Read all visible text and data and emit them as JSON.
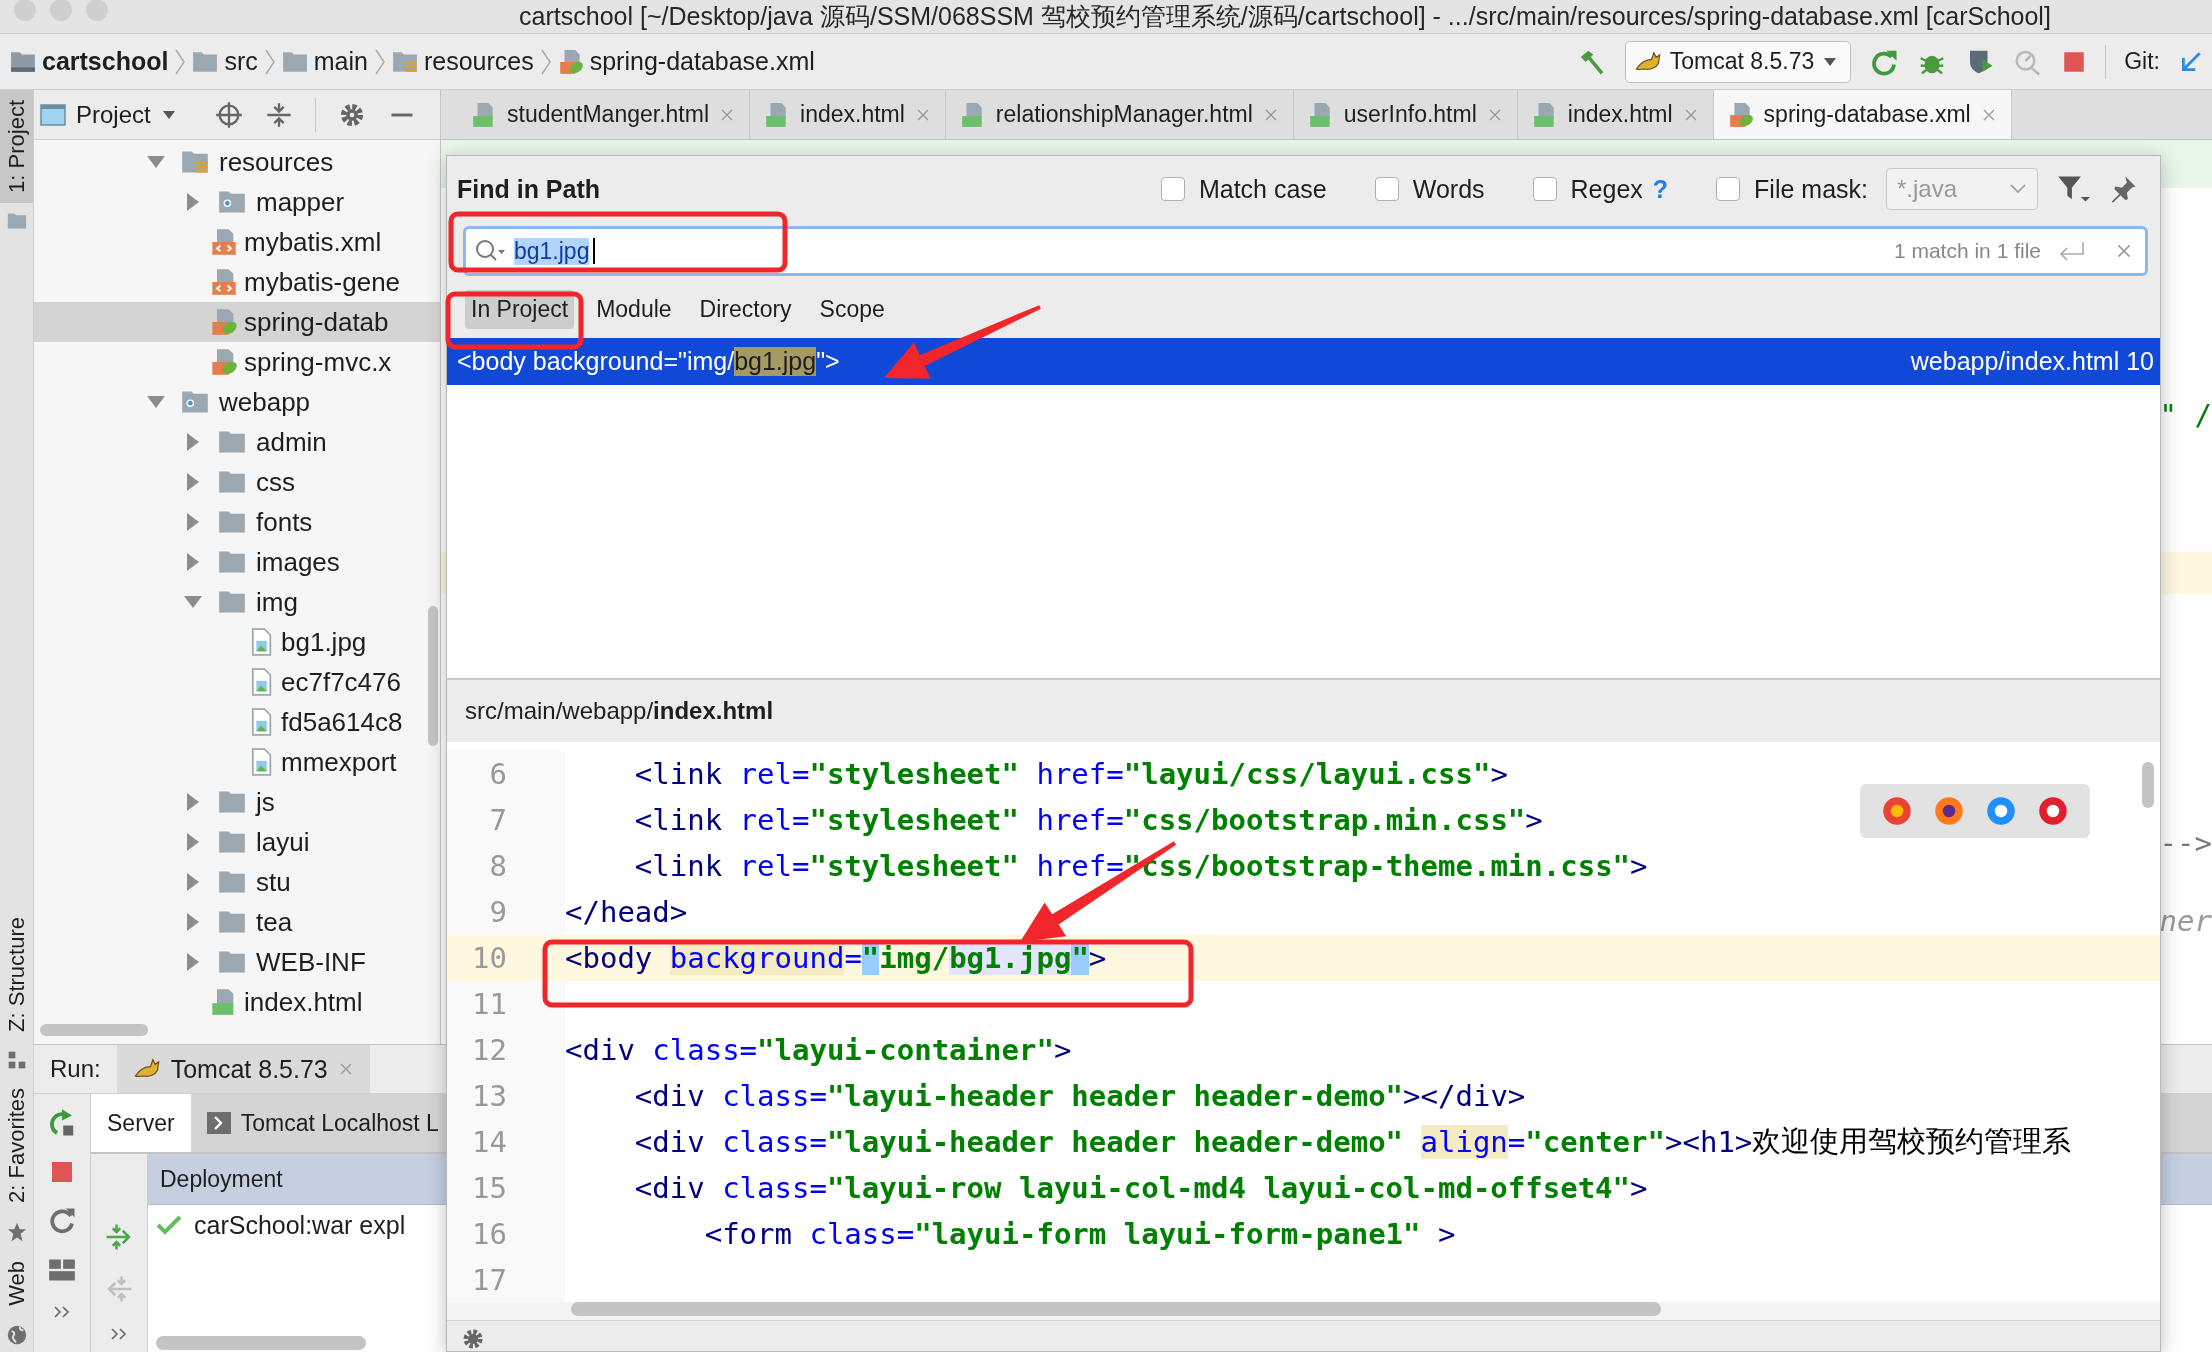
{
  "window": {
    "title": "cartschool [~/Desktop/java 源码/SSM/068SSM 驾校预约管理系统/源码/cartschool] - .../src/main/resources/spring-database.xml [carSchool]"
  },
  "breadcrumbs": [
    {
      "label": "cartschool",
      "kind": "project"
    },
    {
      "label": "src",
      "kind": "folder"
    },
    {
      "label": "main",
      "kind": "folder"
    },
    {
      "label": "resources",
      "kind": "resources"
    },
    {
      "label": "spring-database.xml",
      "kind": "spring"
    }
  ],
  "run_config": {
    "label": "Tomcat 8.5.73"
  },
  "vcs": {
    "label": "Git:"
  },
  "side_stripe": [
    {
      "label": "1: Project",
      "selected": true
    },
    {
      "label": "Z: Structure",
      "selected": false
    },
    {
      "label": "2: Favorites",
      "selected": false
    },
    {
      "label": "Web",
      "selected": false
    }
  ],
  "project_toolbar": {
    "label": "Project"
  },
  "project_tree": [
    {
      "label": "resources",
      "kind": "resources",
      "expanded": true,
      "selected": false,
      "children": [
        {
          "label": "mapper",
          "kind": "web",
          "expanded": false,
          "selected": false
        },
        {
          "label": "mybatis.xml",
          "kind": "xml",
          "selected": false
        },
        {
          "label": "mybatis-gene",
          "kind": "xml",
          "selected": false
        },
        {
          "label": "spring-datab",
          "kind": "spring",
          "selected": true
        },
        {
          "label": "spring-mvc.x",
          "kind": "spring",
          "selected": false
        }
      ]
    },
    {
      "label": "webapp",
      "kind": "web",
      "expanded": true,
      "selected": false,
      "children": [
        {
          "label": "admin",
          "kind": "folder",
          "expanded": false,
          "selected": false
        },
        {
          "label": "css",
          "kind": "folder",
          "expanded": false,
          "selected": false
        },
        {
          "label": "fonts",
          "kind": "folder",
          "expanded": false,
          "selected": false
        },
        {
          "label": "images",
          "kind": "folder",
          "expanded": false,
          "selected": false
        },
        {
          "label": "img",
          "kind": "folder",
          "expanded": true,
          "selected": false,
          "children": [
            {
              "label": "bg1.jpg",
              "kind": "image",
              "selected": false
            },
            {
              "label": "ec7f7c476",
              "kind": "image",
              "selected": false
            },
            {
              "label": "fd5a614c8",
              "kind": "image",
              "selected": false
            },
            {
              "label": "mmexport",
              "kind": "image",
              "selected": false
            }
          ]
        },
        {
          "label": "js",
          "kind": "folder",
          "expanded": false,
          "selected": false
        },
        {
          "label": "layui",
          "kind": "folder",
          "expanded": false,
          "selected": false
        },
        {
          "label": "stu",
          "kind": "folder",
          "expanded": false,
          "selected": false
        },
        {
          "label": "tea",
          "kind": "folder",
          "expanded": false,
          "selected": false
        },
        {
          "label": "WEB-INF",
          "kind": "folder",
          "expanded": false,
          "selected": false
        },
        {
          "label": "index.html",
          "kind": "html",
          "selected": false
        }
      ]
    }
  ],
  "editor_tabs": [
    {
      "label": "studentManger.html",
      "kind": "html",
      "selected": false
    },
    {
      "label": "index.html",
      "kind": "html",
      "selected": false
    },
    {
      "label": "relationshipManager.html",
      "kind": "html",
      "selected": false
    },
    {
      "label": "userInfo.html",
      "kind": "html",
      "selected": false
    },
    {
      "label": "index.html",
      "kind": "html",
      "selected": false
    },
    {
      "label": "spring-database.xml",
      "kind": "spring",
      "selected": true
    }
  ],
  "background_editor": {
    "fragments": [
      "\" /",
      "-->",
      "ner"
    ]
  },
  "run_panel": {
    "label": "Run:",
    "tab": {
      "label": "Tomcat 8.5.73"
    },
    "tabs": [
      {
        "label": "Server",
        "selected": true
      },
      {
        "label": "Tomcat Localhost L",
        "selected": false
      }
    ],
    "column": "Deployment",
    "deployments": [
      {
        "label": "carSchool:war expl",
        "deployed": true
      }
    ]
  },
  "find_dialog": {
    "title": "Find in Path",
    "options": [
      {
        "label": "Match case",
        "checked": false
      },
      {
        "label": "Words",
        "checked": false
      },
      {
        "label": "Regex",
        "checked": false,
        "help": "?"
      },
      {
        "label": "File mask:",
        "checked": false
      }
    ],
    "file_mask": {
      "value": "*.java",
      "disabled": true
    },
    "search": {
      "value": "bg1.jpg",
      "match_count": "1 match in 1 file"
    },
    "scopes": [
      {
        "label": "In Project",
        "selected": true
      },
      {
        "label": "Module",
        "selected": false
      },
      {
        "label": "Directory",
        "selected": false
      },
      {
        "label": "Scope",
        "selected": false
      }
    ],
    "results": [
      {
        "prefix": "<body background=\"img/",
        "match": "bg1.jpg",
        "suffix": "\">",
        "location": "webapp/index.html 10",
        "selected": true
      }
    ],
    "preview": {
      "path": "src/main/webapp/**index.html**",
      "lines": [
        {
          "number": "6",
          "current": false,
          "tokens": [
            {
              "kind": "tag",
              "text": "    <link"
            },
            {
              "kind": "attr",
              "text": " rel="
            },
            {
              "kind": "val",
              "text": "\"stylesheet\""
            },
            {
              "kind": "attr",
              "text": " href="
            },
            {
              "kind": "val",
              "text": "\"layui/css/layui.css\""
            },
            {
              "kind": "tag",
              "text": ">"
            }
          ]
        },
        {
          "number": "7",
          "current": false,
          "tokens": [
            {
              "kind": "tag",
              "text": "    <link"
            },
            {
              "kind": "attr",
              "text": " rel="
            },
            {
              "kind": "val",
              "text": "\"stylesheet\""
            },
            {
              "kind": "attr",
              "text": " href="
            },
            {
              "kind": "val",
              "text": "\"css/bootstrap.min.css\""
            },
            {
              "kind": "tag",
              "text": ">"
            }
          ]
        },
        {
          "number": "8",
          "current": false,
          "tokens": [
            {
              "kind": "tag",
              "text": "    <link"
            },
            {
              "kind": "attr",
              "text": " rel="
            },
            {
              "kind": "val",
              "text": "\"stylesheet\""
            },
            {
              "kind": "attr",
              "text": " href="
            },
            {
              "kind": "val",
              "text": "\"css/bootstrap-theme.min.css\""
            },
            {
              "kind": "tag",
              "text": ">"
            }
          ]
        },
        {
          "number": "9",
          "current": false,
          "tokens": [
            {
              "kind": "tag",
              "text": "</head>"
            }
          ]
        },
        {
          "number": "10",
          "current": true,
          "tokens": [
            {
              "kind": "tag",
              "text": "<body "
            },
            {
              "kind": "attr",
              "text": "background",
              "color": "#f5ebc0"
            },
            {
              "kind": "attr",
              "text": "="
            },
            {
              "kind": "val",
              "text": "\"",
              "color": "#99ccff"
            },
            {
              "kind": "val",
              "text": "img/"
            },
            {
              "kind": "val",
              "text": "bg1.jpg",
              "color": "#e4e4ff"
            },
            {
              "kind": "val",
              "text": "\"",
              "color": "#99ccff"
            },
            {
              "kind": "tag",
              "text": ">"
            }
          ]
        },
        {
          "number": "11",
          "current": false
        },
        {
          "number": "12",
          "current": false,
          "tokens": [
            {
              "kind": "tag",
              "text": "<div"
            },
            {
              "kind": "attr",
              "text": " class="
            },
            {
              "kind": "val",
              "text": "\"layui-container\""
            },
            {
              "kind": "tag",
              "text": ">"
            }
          ]
        },
        {
          "number": "13",
          "current": false,
          "tokens": [
            {
              "kind": "tag",
              "text": "    <div"
            },
            {
              "kind": "attr",
              "text": " class="
            },
            {
              "kind": "val",
              "text": "\"layui-header header header-demo\""
            },
            {
              "kind": "tag",
              "text": "></div>"
            }
          ]
        },
        {
          "number": "14",
          "current": false,
          "tokens": [
            {
              "kind": "tag",
              "text": "    <div"
            },
            {
              "kind": "attr",
              "text": " class="
            },
            {
              "kind": "val",
              "text": "\"layui-header header header-demo\" "
            },
            {
              "kind": "attr",
              "text": "align",
              "color": "#f5ebc0"
            },
            {
              "kind": "attr",
              "text": "="
            },
            {
              "kind": "val",
              "text": "\"center\""
            },
            {
              "kind": "tag",
              "text": "><h1>"
            },
            {
              "kind": "text",
              "text": "欢迎使用驾校预约管理系"
            }
          ]
        },
        {
          "number": "15",
          "current": false,
          "tokens": [
            {
              "kind": "tag",
              "text": "    <div"
            },
            {
              "kind": "attr",
              "text": " class="
            },
            {
              "kind": "val",
              "text": "\"layui-row layui-col-md4 layui-col-md-offset4\""
            },
            {
              "kind": "tag",
              "text": ">"
            }
          ]
        },
        {
          "number": "16",
          "current": false,
          "tokens": [
            {
              "kind": "tag",
              "text": "        <form"
            },
            {
              "kind": "attr",
              "text": " class="
            },
            {
              "kind": "val",
              "text": "\"layui-form layui-form-pane1\""
            },
            {
              "kind": "tag",
              "text": " >"
            }
          ]
        },
        {
          "number": "17",
          "current": false
        }
      ]
    }
  }
}
